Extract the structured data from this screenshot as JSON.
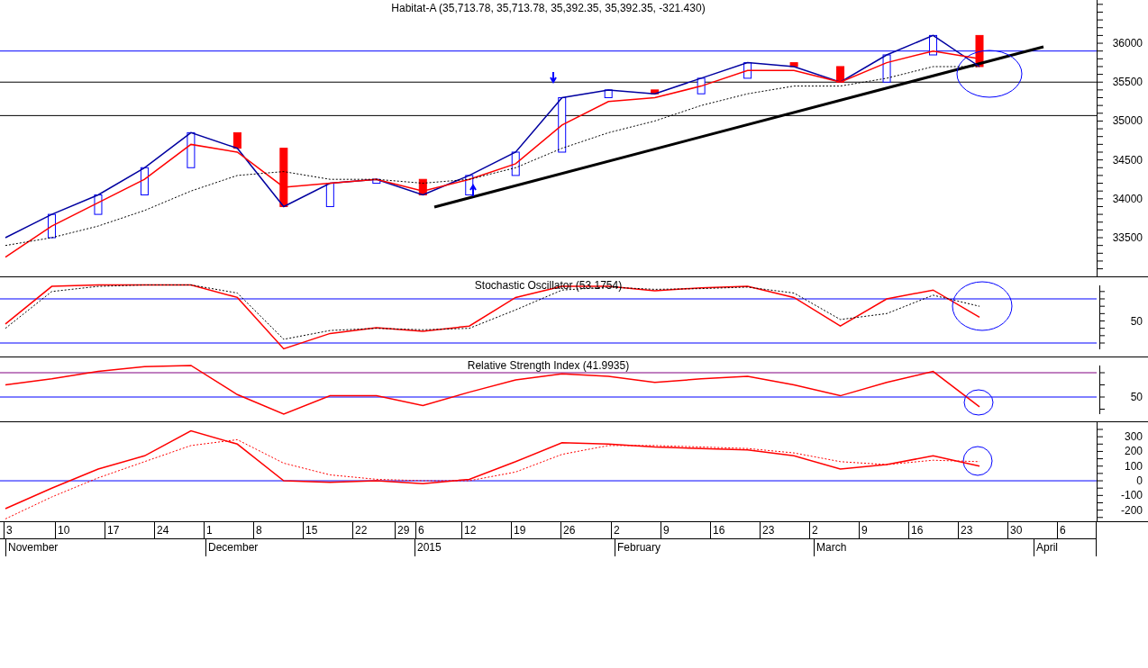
{
  "price_chart": {
    "title": "Habitat-A (35,713.78, 35,713.78, 35,392.35, 35,392.35, -321.430)",
    "chart_data": {
      "type": "line",
      "ylim": [
        32991,
        36556
      ],
      "yticks": [
        33500,
        34000,
        34500,
        35000,
        35500,
        36000
      ],
      "series": [
        {
          "color": "#0000a0",
          "line_style": "solid",
          "values": [
            33500,
            33800,
            34050,
            34400,
            34850,
            34650,
            33900,
            34200,
            34250,
            34050,
            34300,
            34600,
            35300,
            35400,
            35350,
            35550,
            35750,
            35700,
            35500,
            35850,
            36100,
            35700
          ]
        },
        {
          "color": "#ff0000",
          "line_style": "solid",
          "values": [
            33250,
            33650,
            33950,
            34250,
            34700,
            34600,
            34150,
            34200,
            34250,
            34100,
            34250,
            34450,
            34950,
            35250,
            35300,
            35450,
            35650,
            35650,
            35500,
            35750,
            35900,
            35800
          ]
        },
        {
          "color": "#000000",
          "line_style": "dashed",
          "values": [
            33400,
            33500,
            33650,
            33850,
            34100,
            34300,
            34350,
            34250,
            34250,
            34200,
            34250,
            34400,
            34650,
            34850,
            35000,
            35200,
            35350,
            35450,
            35450,
            35550,
            35700,
            35700
          ]
        }
      ]
    }
  },
  "stochastic_chart": {
    "title": "Stochastic Oscillator (53.1754)",
    "axis_label": "50"
  },
  "rsi_chart": {
    "title": "Relative Strength Index (41.9935)",
    "axis_label": "50"
  },
  "macd_chart": {
    "chart_data": {
      "type": "line",
      "ylim": [
        -282,
        399
      ],
      "yticks": [
        300,
        200,
        100,
        0,
        -100,
        -200
      ],
      "series": [
        {
          "color": "#ff0000",
          "line_style": "solid",
          "values": [
            -190,
            -50,
            80,
            170,
            340,
            250,
            0,
            -10,
            0,
            -20,
            10,
            130,
            260,
            250,
            230,
            220,
            210,
            170,
            80,
            110,
            170,
            100
          ]
        },
        {
          "color": "#ff0000",
          "line_style": "dashed",
          "values": [
            -260,
            -110,
            20,
            130,
            240,
            280,
            120,
            40,
            10,
            0,
            0,
            60,
            180,
            240,
            240,
            230,
            220,
            190,
            130,
            110,
            140,
            130
          ]
        }
      ]
    }
  },
  "date_axis": {
    "days": [
      "3",
      "10",
      "17",
      "24",
      "1",
      "8",
      "15",
      "22",
      "29",
      "6",
      "12",
      "19",
      "26",
      "2",
      "9",
      "16",
      "23",
      "2",
      "9",
      "16",
      "23",
      "30",
      "6"
    ],
    "months": [
      "November",
      "December",
      "2015",
      "February",
      "March",
      "April"
    ]
  }
}
